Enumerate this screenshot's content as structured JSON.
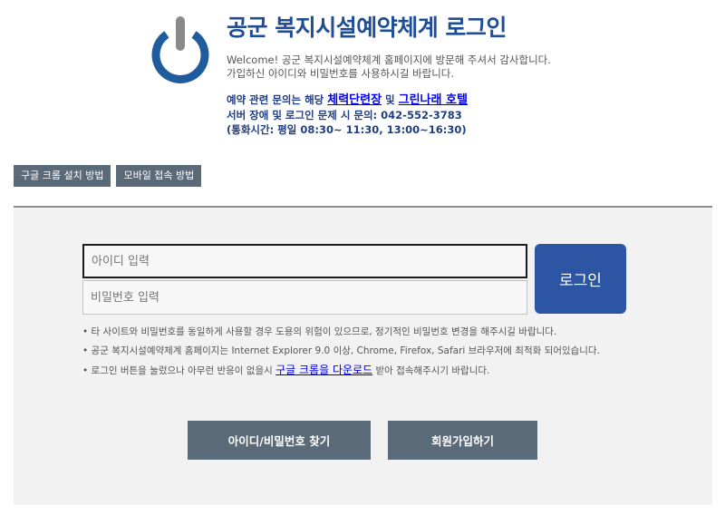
{
  "header": {
    "title": "공군 복지시설예약체계 로그인",
    "welcome_line1": "Welcome! 공군 복지시설예약체계 홈페이지에 방문해 주셔서 감사합니다.",
    "welcome_line2": "가입하신 아이디와 비밀번호를 사용하시길 바랍니다.",
    "inquiry_prefix": "예약 관련 문의는 해당 ",
    "inquiry_link1": "체력단련장",
    "inquiry_mid": " 및 ",
    "inquiry_link2": "그린나래 호텔",
    "error_contact": "서버 장애 및 로그인 문제 시 문의: 042-552-3783",
    "call_hours": "(통화시간: 평일 08:30~ 11:30, 13:00~16:30)"
  },
  "top_buttons": {
    "chrome_install": "구글 크롬 설치 방법",
    "mobile_access": "모바일 접속 방법"
  },
  "login": {
    "id_placeholder": "아이디 입력",
    "pw_placeholder": "비밀번호 입력",
    "login_label": "로그인"
  },
  "notices": {
    "line1": "• 타 사이트와 비밀번호를 동일하게 사용할 경우 도용의 위험이 있으므로, 정기적인 비밀번호 변경을 해주시길 바랍니다.",
    "line2": "• 공군 복지시설예약체계 홈페이지는 Internet Explorer 9.0 이상, Chrome, Firefox, Safari 브라우저에 최적화 되어있습니다.",
    "line3_prefix": "• 로그인 버튼을 눌렀으나 아무런 반응이 없을시 ",
    "line3_link": "구글 크롬을 다운로드",
    "line3_suffix": " 받아 접속해주시기 바랍니다."
  },
  "bottom_buttons": {
    "find_account": "아이디/비밀번호 찾기",
    "sign_up": "회원가입하기"
  },
  "colors": {
    "title": "#1f4e96",
    "logo": "#1f5c9e",
    "button_gray": "#5b6a78",
    "login_blue": "#2c55a3"
  }
}
